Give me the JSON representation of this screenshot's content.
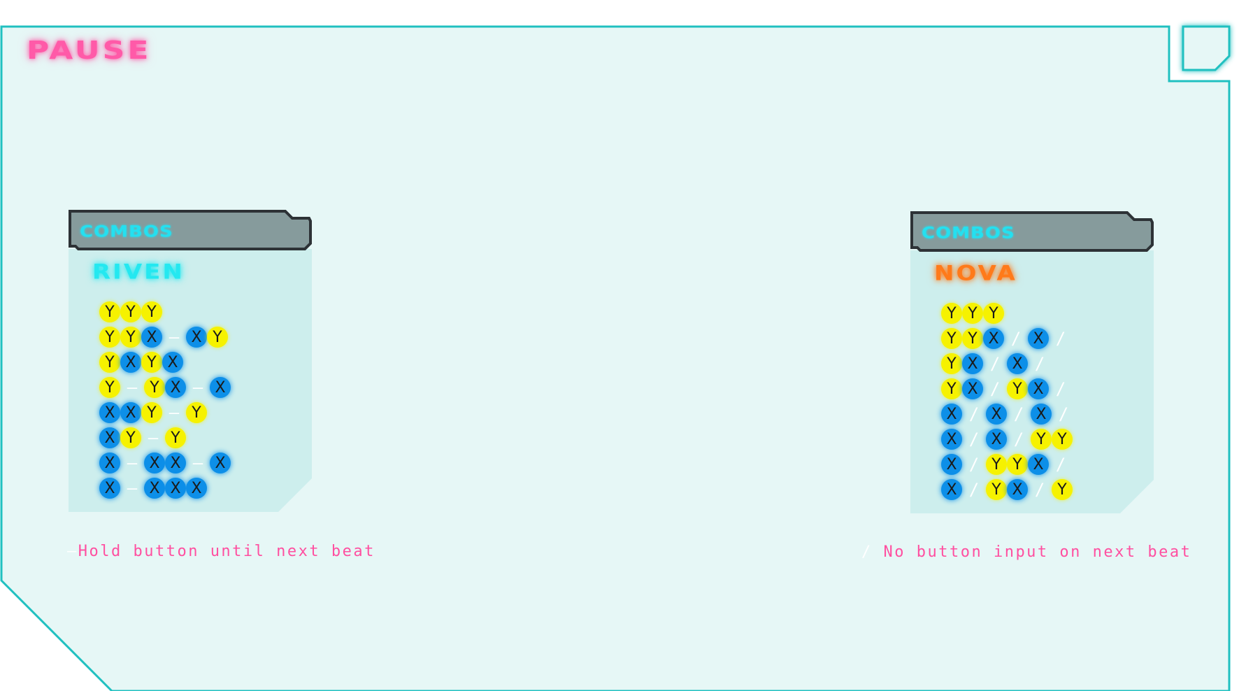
{
  "title": "PAUSE",
  "colors": {
    "accent": "#ff5aa8",
    "frame": "#20c0c0",
    "y_button": "#f6f200",
    "x_button": "#0d8fe8",
    "riven": "#24e8f0",
    "nova": "#ff7a1a"
  },
  "panels": [
    {
      "label": "COMBOS",
      "name": "RIVEN",
      "rows": [
        [
          "Y",
          "Y",
          "Y"
        ],
        [
          "Y",
          "Y",
          "X",
          "—",
          "X",
          "Y"
        ],
        [
          "Y",
          "X",
          "Y",
          "X"
        ],
        [
          "Y",
          "—",
          "Y",
          "X",
          "—",
          "X"
        ],
        [
          "X",
          "X",
          "Y",
          "—",
          "Y"
        ],
        [
          "X",
          "Y",
          "—",
          "Y"
        ],
        [
          "X",
          "—",
          "X",
          "X",
          "—",
          "X"
        ],
        [
          "X",
          "—",
          "X",
          "X",
          "X"
        ]
      ],
      "legend_symbol": "—",
      "legend_text": "Hold button until next beat"
    },
    {
      "label": "COMBOS",
      "name": "NOVA",
      "rows": [
        [
          "Y",
          "Y",
          "Y"
        ],
        [
          "Y",
          "Y",
          "X",
          "/",
          "X",
          "/"
        ],
        [
          "Y",
          "X",
          "/",
          "X",
          "/"
        ],
        [
          "Y",
          "X",
          "/",
          "Y",
          "X",
          "/"
        ],
        [
          "X",
          "/",
          "X",
          "/",
          "X",
          "/"
        ],
        [
          "X",
          "/",
          "X",
          "/",
          "Y",
          "Y"
        ],
        [
          "X",
          "/",
          "Y",
          "Y",
          "X",
          "/"
        ],
        [
          "X",
          "/",
          "Y",
          "X",
          "/",
          "Y"
        ]
      ],
      "legend_symbol": "/",
      "legend_text": "No button input on next beat"
    }
  ]
}
